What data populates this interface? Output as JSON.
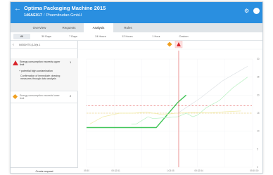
{
  "header": {
    "back_icon": "arrow-left-icon",
    "title": "Optima Packaging Machine 2015",
    "asset_id": "146AE017",
    "separator": "/",
    "asset_name": "Pharmitrudan GmbH",
    "settings_icon": "gear-icon",
    "user_icon": "avatar-icon",
    "color": "#2a8fe0"
  },
  "tabs": [
    {
      "label": "Overview",
      "active": false
    },
    {
      "label": "Requests",
      "active": false
    },
    {
      "label": "Analysis",
      "active": true
    },
    {
      "label": "Rules",
      "active": false
    }
  ],
  "time_ranges": [
    {
      "label": "All",
      "active": true
    },
    {
      "label": "30 Days",
      "active": false
    },
    {
      "label": "7 Days",
      "active": false
    },
    {
      "label": "24 Hours",
      "active": false
    },
    {
      "label": "12 Hours",
      "active": false
    },
    {
      "label": "1 Hour",
      "active": false
    },
    {
      "label": "Custom",
      "active": false
    }
  ],
  "filter": {
    "label": "INSIGHTS (1/2(ts 1",
    "chevron_icon": "chevron-left-icon"
  },
  "events": [
    {
      "severity": "high",
      "icon": "warning-triangle-icon",
      "color": "#d9262c",
      "title": "Energy consumption exceeds upper limit",
      "count": "1",
      "cause": "+ potential high contamination",
      "description": "Confirmation of immediate cleaning measures through data analysis"
    },
    {
      "severity": "medium",
      "icon": "warning-diamond-icon",
      "color": "#f0a020",
      "title": "Energy consumption exceeds lower limit",
      "count": "2"
    }
  ],
  "actions": {
    "create_request": "Create request"
  },
  "chart_data": {
    "type": "line",
    "x_tick_labels": [
      "09:30",
      "09:32:51",
      "",
      "1:03:05",
      "09:32:54",
      "",
      "09:30:00"
    ],
    "y_tick_labels": [
      "30",
      "25",
      "20",
      "15",
      "10",
      "5",
      "0"
    ],
    "ylim": [
      0,
      30
    ],
    "markers": [
      {
        "kind": "warning-diamond",
        "color": "#f0a020",
        "x": 0.5
      },
      {
        "kind": "warning-triangle",
        "color": "#d9262c",
        "x": 0.555
      }
    ],
    "thresholds": [
      {
        "name": "upper",
        "value": 17,
        "color": "#e05555",
        "style": "dotted"
      },
      {
        "name": "lower",
        "value": 15,
        "color": "#e8c860",
        "style": "dashed"
      }
    ],
    "series": [
      {
        "color": "#43c65a",
        "x": [
          0,
          0.02,
          0.42,
          0.55,
          0.6
        ],
        "y": [
          11,
          11,
          11,
          18,
          20
        ]
      },
      {
        "color": "#b7f0c0",
        "x": [
          0.27,
          0.3,
          0.37,
          0.4,
          0.55,
          0.6,
          0.64,
          0.67,
          0.72,
          0.8,
          0.88,
          0.97
        ],
        "y": [
          12,
          12,
          14,
          13.5,
          14,
          15,
          14,
          14.5,
          16.5,
          18.5,
          22,
          25
        ]
      },
      {
        "color": "#f1eba8",
        "x": [
          0.02,
          0.1,
          0.2,
          0.28,
          0.36,
          0.46,
          0.54,
          0.64,
          0.74,
          0.84,
          0.93
        ],
        "y": [
          12,
          14,
          15,
          15,
          15.3,
          14.6,
          15,
          15.2,
          15.1,
          15.4,
          15.6
        ]
      },
      {
        "color": "#dfe3e6",
        "x": [
          0.55,
          0.68,
          0.82,
          0.97
        ],
        "y": [
          15,
          19,
          24,
          28
        ]
      }
    ],
    "cursor_x": 0.555
  }
}
